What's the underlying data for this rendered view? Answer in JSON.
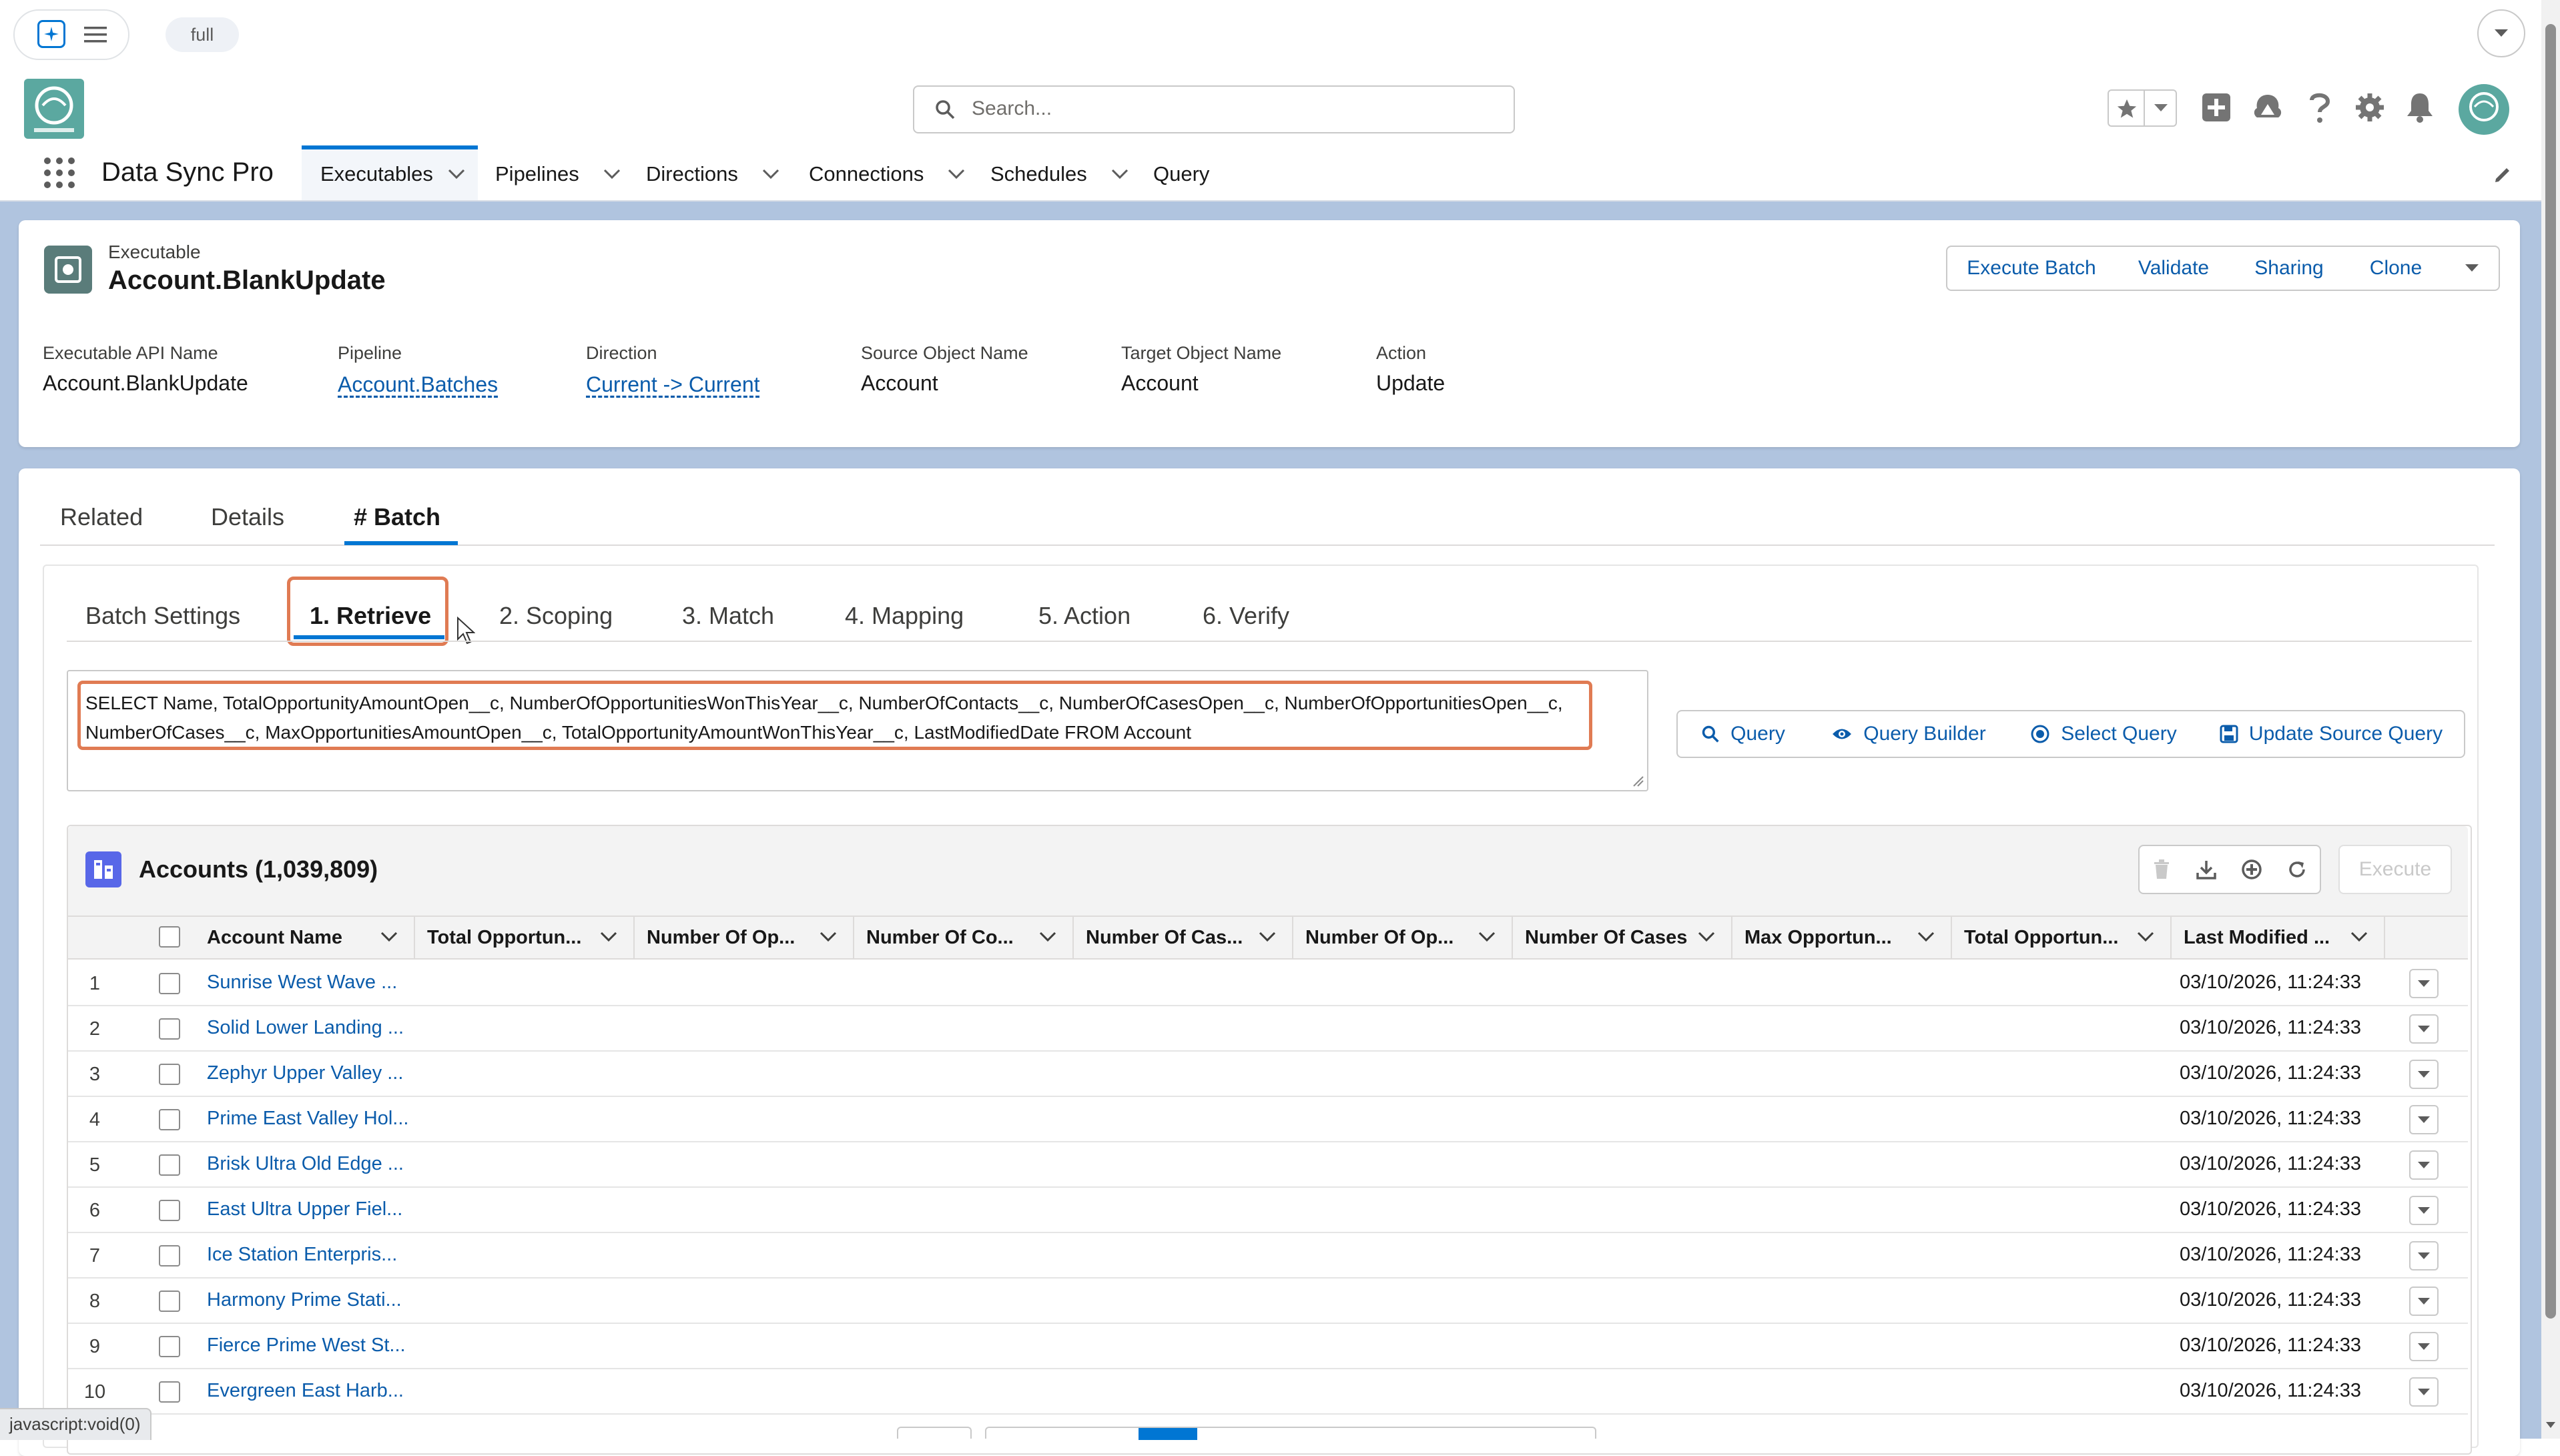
{
  "env_badge": "full",
  "app_name": "Data Sync Pro",
  "search_placeholder": "Search...",
  "nav_tabs": [
    {
      "label": "Executables",
      "active": true,
      "has_menu": true
    },
    {
      "label": "Pipelines",
      "has_menu": true
    },
    {
      "label": "Directions",
      "has_menu": true
    },
    {
      "label": "Connections",
      "has_menu": true
    },
    {
      "label": "Schedules",
      "has_menu": true
    },
    {
      "label": "Query",
      "has_menu": false
    }
  ],
  "record": {
    "object_label": "Executable",
    "name": "Account.BlankUpdate",
    "actions": [
      "Execute Batch",
      "Validate",
      "Sharing",
      "Clone"
    ],
    "fields": [
      {
        "label": "Executable API Name",
        "value": "Account.BlankUpdate",
        "link": false
      },
      {
        "label": "Pipeline",
        "value": "Account.Batches",
        "link": true
      },
      {
        "label": "Direction",
        "value": "Current -> Current",
        "link": true
      },
      {
        "label": "Source Object Name",
        "value": "Account",
        "link": false
      },
      {
        "label": "Target Object Name",
        "value": "Account",
        "link": false
      },
      {
        "label": "Action",
        "value": "Update",
        "link": false
      }
    ]
  },
  "record_tabs": [
    "Related",
    "Details",
    "# Batch"
  ],
  "batch_tabs": [
    "Batch Settings",
    "1. Retrieve",
    "2. Scoping",
    "3. Match",
    "4. Mapping",
    "5. Action",
    "6. Verify"
  ],
  "query_text": "SELECT Name, TotalOpportunityAmountOpen__c, NumberOfOpportunitiesWonThisYear__c, NumberOfContacts__c, NumberOfCasesOpen__c, NumberOfOpportunitiesOpen__c, NumberOfCases__c, MaxOpportunitiesAmountOpen__c, TotalOpportunityAmountWonThisYear__c, LastModifiedDate FROM Account",
  "query_buttons": [
    "Query",
    "Query Builder",
    "Select Query",
    "Update Source Query"
  ],
  "table": {
    "title": "Accounts (1,039,809)",
    "execute_label": "Execute",
    "columns": [
      "Account Name",
      "Total Opportun...",
      "Number Of Op...",
      "Number Of Co...",
      "Number Of Cas...",
      "Number Of Op...",
      "Number Of Cases",
      "Max Opportun...",
      "Total Opportun...",
      "Last Modified ..."
    ],
    "rows": [
      {
        "num": "1",
        "name": "Sunrise West Wave ...",
        "modified": "03/10/2026, 11:24:33"
      },
      {
        "num": "2",
        "name": "Solid Lower Landing ...",
        "modified": "03/10/2026, 11:24:33"
      },
      {
        "num": "3",
        "name": "Zephyr Upper Valley ...",
        "modified": "03/10/2026, 11:24:33"
      },
      {
        "num": "4",
        "name": "Prime East Valley Hol...",
        "modified": "03/10/2026, 11:24:33"
      },
      {
        "num": "5",
        "name": "Brisk Ultra Old Edge ...",
        "modified": "03/10/2026, 11:24:33"
      },
      {
        "num": "6",
        "name": "East Ultra Upper Fiel...",
        "modified": "03/10/2026, 11:24:33"
      },
      {
        "num": "7",
        "name": "Ice Station Enterpris...",
        "modified": "03/10/2026, 11:24:33"
      },
      {
        "num": "8",
        "name": "Harmony Prime Stati...",
        "modified": "03/10/2026, 11:24:33"
      },
      {
        "num": "9",
        "name": "Fierce Prime West St...",
        "modified": "03/10/2026, 11:24:33"
      },
      {
        "num": "10",
        "name": "Evergreen East Harb...",
        "modified": "03/10/2026, 11:24:33"
      }
    ]
  },
  "status_bar": "javascript:void(0)",
  "colors": {
    "brand": "#0176d3",
    "link": "#0b5cab",
    "highlight": "#e07b53",
    "page_bg": "#b0c4df"
  }
}
